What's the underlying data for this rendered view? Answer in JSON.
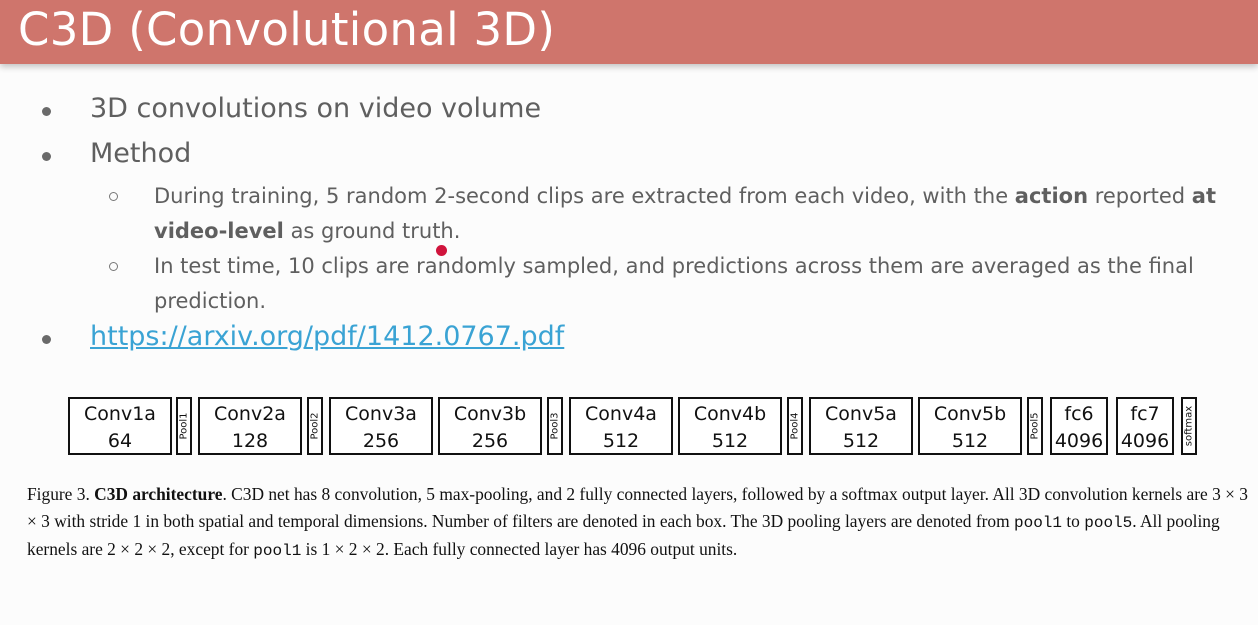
{
  "slide": {
    "title": "C3D (Convolutional 3D)"
  },
  "bullets": {
    "b1": "3D convolutions on video volume",
    "b2": "Method",
    "link": "https://arxiv.org/pdf/1412.0767.pdf"
  },
  "sub1": {
    "p1": "During training, 5 random 2-second clips are extracted from each video, with the ",
    "b1": "action",
    "p2": " reported ",
    "b2": "at video-level",
    "p3": " as ground truth."
  },
  "sub2": "In test time, 10 clips are randomly sampled, and predictions across them are averaged as the final prediction.",
  "architecture": {
    "blocks": [
      {
        "name": "Conv1a",
        "value": "64"
      },
      {
        "pool": "Pool1"
      },
      {
        "name": "Conv2a",
        "value": "128"
      },
      {
        "pool": "Pool2"
      },
      {
        "name": "Conv3a",
        "value": "256"
      },
      {
        "name": "Conv3b",
        "value": "256"
      },
      {
        "pool": "Pool3"
      },
      {
        "name": "Conv4a",
        "value": "512"
      },
      {
        "name": "Conv4b",
        "value": "512"
      },
      {
        "pool": "Pool4"
      },
      {
        "name": "Conv5a",
        "value": "512"
      },
      {
        "name": "Conv5b",
        "value": "512"
      },
      {
        "pool": "Pool5"
      },
      {
        "name": "fc6",
        "value": "4096"
      },
      {
        "name": "fc7",
        "value": "4096"
      },
      {
        "pool": "softmax"
      }
    ]
  },
  "caption": {
    "t1": "Figure 3. ",
    "t2": "C3D architecture",
    "t3": ". C3D net has 8 convolution, 5 max-pooling, and 2 fully connected layers, followed by a softmax output layer. All 3D convolution kernels are 3 × 3 × 3 with stride 1 in both spatial and temporal dimensions. Number of filters are denoted in each box. The 3D pooling layers are denoted from ",
    "c1": "pool1",
    "t4": " to ",
    "c2": "pool5",
    "t5": ". All pooling kernels are 2 × 2 × 2, except for ",
    "c3": "pool1",
    "t6": " is 1 × 2 × 2. Each fully connected layer has 4096 output units."
  }
}
